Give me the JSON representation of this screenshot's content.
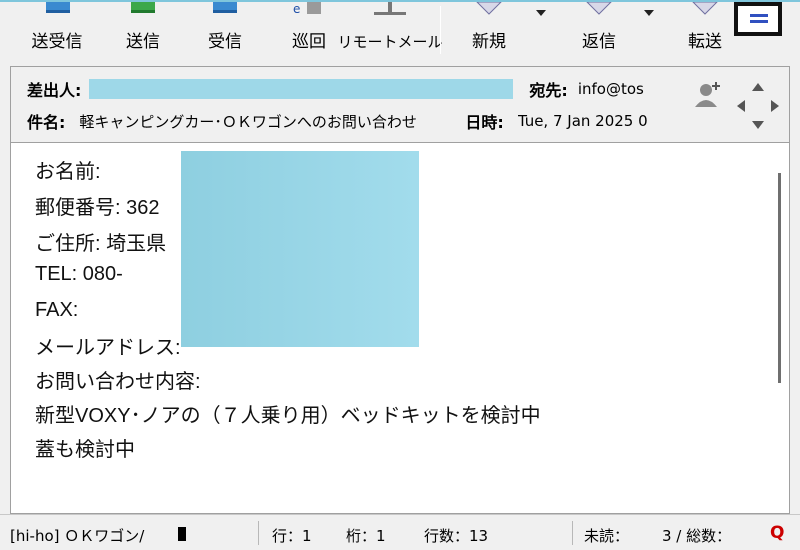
{
  "toolbar": {
    "buttons": [
      {
        "label": "送受信",
        "icon": "send-receive-icon"
      },
      {
        "label": "送信",
        "icon": "send-icon"
      },
      {
        "label": "受信",
        "icon": "receive-icon"
      },
      {
        "label": "巡回",
        "icon": "patrol-icon"
      },
      {
        "label": "リモートメール",
        "icon": "remote-mail-icon"
      },
      {
        "label": "新規",
        "icon": "new-mail-icon"
      },
      {
        "label": "返信",
        "icon": "reply-icon"
      },
      {
        "label": "転送",
        "icon": "forward-icon"
      }
    ]
  },
  "header": {
    "from_label": "差出人:",
    "to_label": "宛先:",
    "to_value": "info@tos",
    "subject_label": "件名:",
    "subject_value": "軽キャンピングカー･ＯＫワゴンへのお問い合わせ",
    "date_label": "日時:",
    "date_value": "Tue, 7 Jan 2025 0"
  },
  "body": {
    "lines": [
      "お名前:",
      "郵便番号: 362",
      "ご住所: 埼玉県",
      "TEL:        080-",
      "FAX:",
      "メールアドレス:",
      "お問い合わせ内容:",
      "新型VOXY･ノアの（７人乗り用）ベッドキットを検討中",
      "蓋も検討中"
    ]
  },
  "status": {
    "folder": "[hi-ho] ＯＫワゴン/",
    "row": "行：1",
    "col": "桁：1",
    "lines": "行数：13",
    "unread": "未読：",
    "total": "3 / 総数：",
    "q": "Q"
  },
  "colors": {
    "accent": "#7fc6dc",
    "redaction": "#9ed8e8",
    "link": "#1a3ad6",
    "q_red": "#cc0000"
  }
}
